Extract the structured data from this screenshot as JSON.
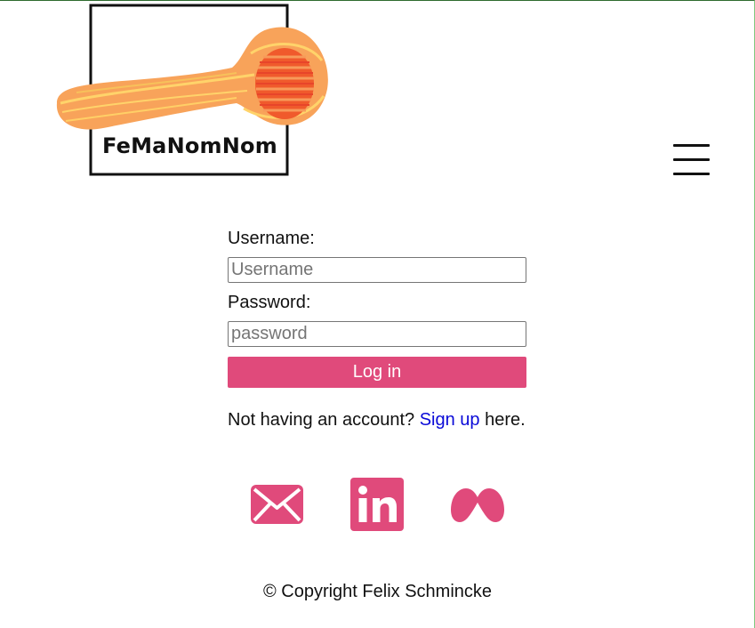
{
  "brand": {
    "name": "FeMaNomNom",
    "accent_color": "#e04a7b",
    "logo_icon": "wooden-spoon-icon"
  },
  "header": {
    "menu_icon": "hamburger-menu-icon"
  },
  "login": {
    "username_label": "Username:",
    "username_placeholder": "Username",
    "username_value": "",
    "password_label": "Password:",
    "password_placeholder": "password",
    "password_value": "",
    "login_button": "Log in",
    "signup_prefix": "Not having an account?",
    "signup_link": "Sign up",
    "signup_suffix": "here."
  },
  "social": [
    {
      "icon": "mail-icon"
    },
    {
      "icon": "linkedin-icon"
    },
    {
      "icon": "meta-icon"
    }
  ],
  "footer": {
    "copyright": "© Copyright Felix Schmincke"
  }
}
